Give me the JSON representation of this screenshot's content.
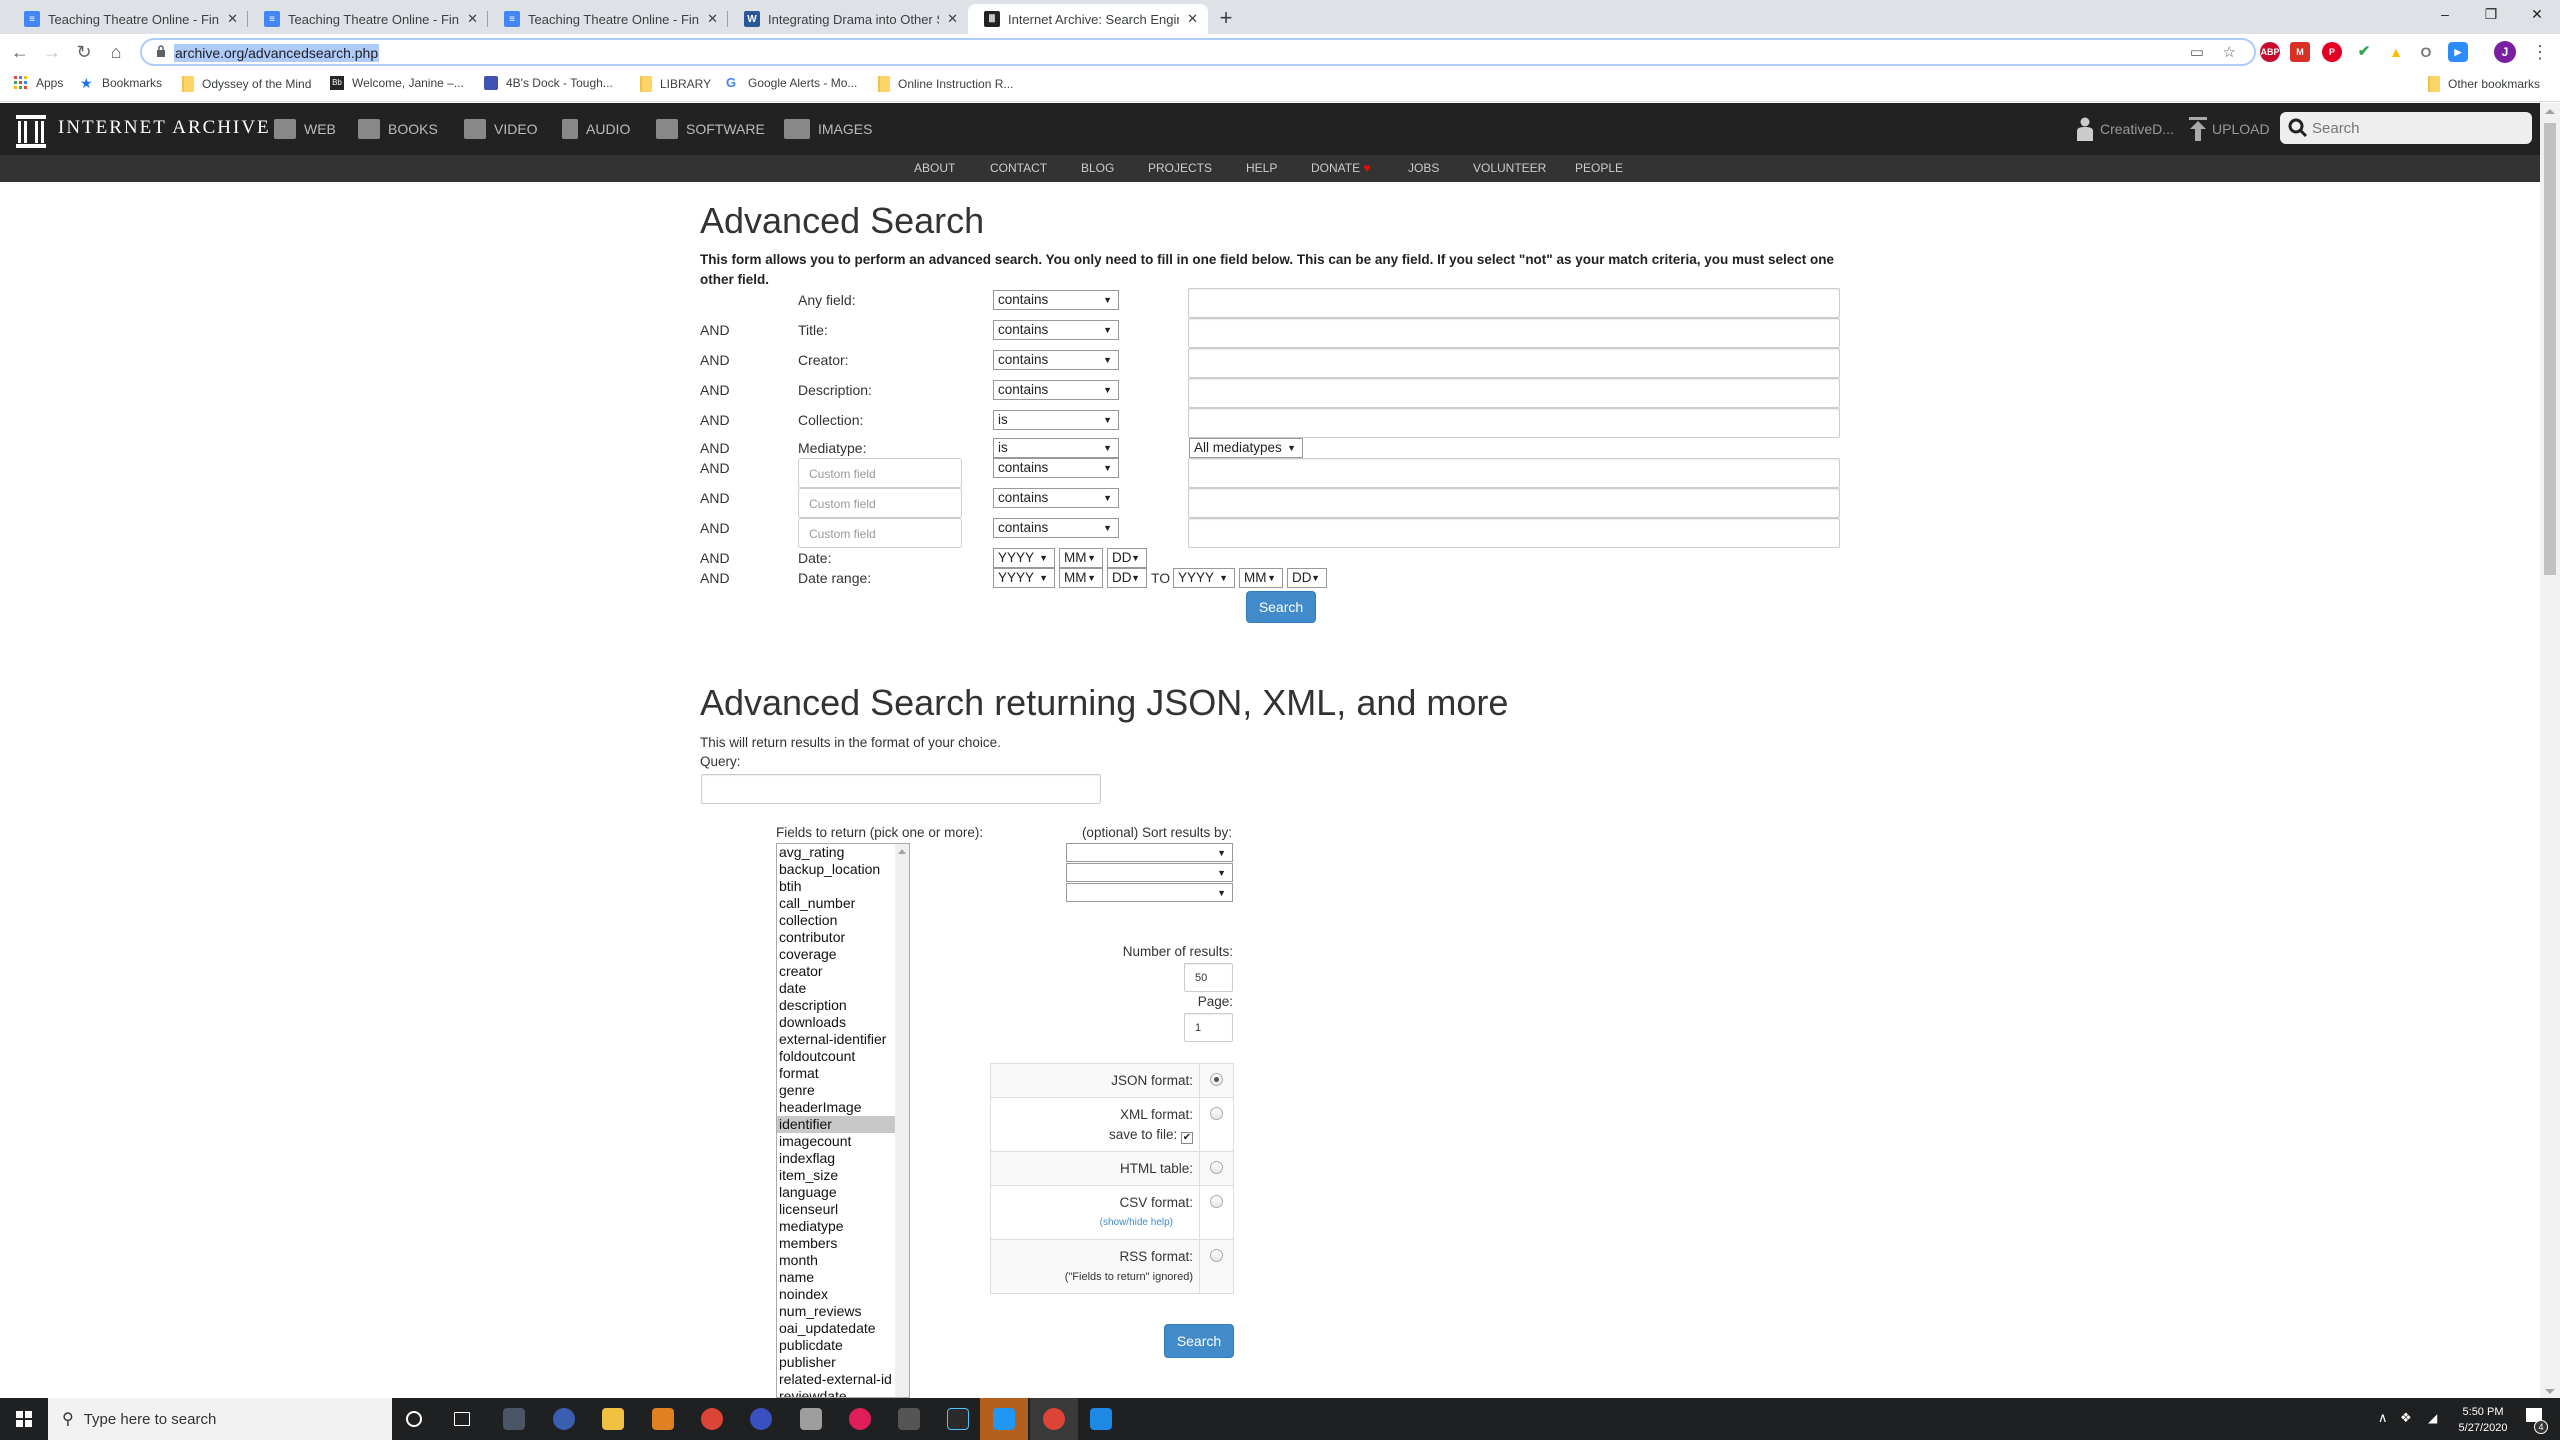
{
  "browser": {
    "tabs": [
      {
        "title": "Teaching Theatre Online - Finding",
        "icon": "google-docs-icon",
        "active": false
      },
      {
        "title": "Teaching Theatre Online - Finding",
        "icon": "google-docs-icon",
        "active": false
      },
      {
        "title": "Teaching Theatre Online - Finding",
        "icon": "google-docs-icon",
        "active": false
      },
      {
        "title": "Integrating Drama into Other Sub",
        "icon": "word-doc-icon",
        "active": false
      },
      {
        "title": "Internet Archive: Search Engine",
        "icon": "internet-archive-icon",
        "active": true
      }
    ],
    "new_tab": "+",
    "close_glyph": "✕",
    "window": {
      "minimize": "–",
      "restore": "❐",
      "close": "✕"
    },
    "url": "archive.org/advancedsearch.php",
    "extensions": [
      {
        "name": "abp",
        "label": "ABP",
        "color": "#c70d2c"
      },
      {
        "name": "gmail",
        "label": "M",
        "color": "#d93025"
      },
      {
        "name": "pinterest",
        "label": "P",
        "color": "#e60023"
      },
      {
        "name": "checker",
        "label": "✔",
        "color": "#34a853"
      },
      {
        "name": "drive",
        "label": "▲",
        "color": "#fbbc04"
      },
      {
        "name": "circle",
        "label": "O",
        "color": "#777777"
      },
      {
        "name": "zoom",
        "label": "▶",
        "color": "#2d8cff"
      }
    ],
    "profile_initial": "J",
    "profile_color": "#7b1fa2",
    "bookmarks": [
      {
        "label": "Apps",
        "icon": "apps-grid-icon"
      },
      {
        "label": "Bookmarks",
        "icon": "star-icon"
      },
      {
        "label": "Odyssey of the Mind",
        "icon": "folder-icon"
      },
      {
        "label": "Welcome, Janine –...",
        "icon": "blackboard-icon"
      },
      {
        "label": "4B's Dock - Tough...",
        "icon": "forms-icon"
      },
      {
        "label": "LIBRARY",
        "icon": "folder-icon"
      },
      {
        "label": "Google Alerts - Mo...",
        "icon": "google-icon"
      },
      {
        "label": "Online Instruction R...",
        "icon": "folder-icon"
      }
    ],
    "other_bookmarks": "Other bookmarks"
  },
  "ia": {
    "logo_text": "INTERNET ARCHIVE",
    "media": [
      "WEB",
      "BOOKS",
      "VIDEO",
      "AUDIO",
      "SOFTWARE",
      "IMAGES"
    ],
    "user": "CreativeD...",
    "upload": "UPLOAD",
    "search_placeholder": "Search",
    "subnav": [
      "ABOUT",
      "CONTACT",
      "BLOG",
      "PROJECTS",
      "HELP",
      "DONATE",
      "JOBS",
      "VOLUNTEER",
      "PEOPLE"
    ],
    "donate_heart_color": "#ff0000"
  },
  "advanced": {
    "title": "Advanced Search",
    "intro": "This form allows you to perform an advanced search. You only need to fill in one field below. This can be any field. If you select \"not\" as your match criteria, you must select one other field.",
    "rows": [
      {
        "conj": "",
        "label": "Any field:",
        "match": "contains"
      },
      {
        "conj": "AND",
        "label": "Title:",
        "match": "contains"
      },
      {
        "conj": "AND",
        "label": "Creator:",
        "match": "contains"
      },
      {
        "conj": "AND",
        "label": "Description:",
        "match": "contains"
      },
      {
        "conj": "AND",
        "label": "Collection:",
        "match": "is"
      },
      {
        "conj": "AND",
        "label": "Mediatype:",
        "match": "is",
        "value": "All mediatypes"
      }
    ],
    "custom_rows": [
      {
        "conj": "AND",
        "placeholder": "Custom field",
        "match": "contains"
      },
      {
        "conj": "AND",
        "placeholder": "Custom field",
        "match": "contains"
      },
      {
        "conj": "AND",
        "placeholder": "Custom field",
        "match": "contains"
      }
    ],
    "date": {
      "conj": "AND",
      "label": "Date:",
      "yyyy": "YYYY",
      "mm": "MM",
      "dd": "DD"
    },
    "date_range": {
      "conj": "AND",
      "label": "Date range:",
      "to": "TO"
    },
    "search_button": "Search"
  },
  "json_search": {
    "title": "Advanced Search returning JSON, XML, and more",
    "desc": "This will return results in the format of your choice.",
    "query_label": "Query:",
    "query_value": "",
    "fields_label": "Fields to return (pick one or more):",
    "fields": [
      "avg_rating",
      "backup_location",
      "btih",
      "call_number",
      "collection",
      "contributor",
      "coverage",
      "creator",
      "date",
      "description",
      "downloads",
      "external-identifier",
      "foldoutcount",
      "format",
      "genre",
      "headerImage",
      "identifier",
      "imagecount",
      "indexflag",
      "item_size",
      "language",
      "licenseurl",
      "mediatype",
      "members",
      "month",
      "name",
      "noindex",
      "num_reviews",
      "oai_updatedate",
      "publicdate",
      "publisher",
      "related-external-id",
      "reviewdate"
    ],
    "selected_field": "identifier",
    "sort_label": "(optional) Sort results by:",
    "sort_values": [
      "",
      "",
      ""
    ],
    "num_results_label": "Number of results:",
    "num_results": "50",
    "page_label": "Page:",
    "page": "1",
    "formats": [
      {
        "label": "JSON format:",
        "selected": true
      },
      {
        "label": "XML format:",
        "selected": false,
        "extra": "save to file:",
        "save_checked": true
      },
      {
        "label": "HTML table:",
        "selected": false
      },
      {
        "label": "CSV format:",
        "selected": false,
        "help": "(show/hide help)"
      },
      {
        "label": "RSS format:",
        "selected": false,
        "note": "(\"Fields to return\" ignored)"
      }
    ],
    "search_button": "Search"
  },
  "taskbar": {
    "search_placeholder": "Type here to search",
    "time": "5:50 PM",
    "date": "5/27/2020",
    "notifications": "4"
  }
}
